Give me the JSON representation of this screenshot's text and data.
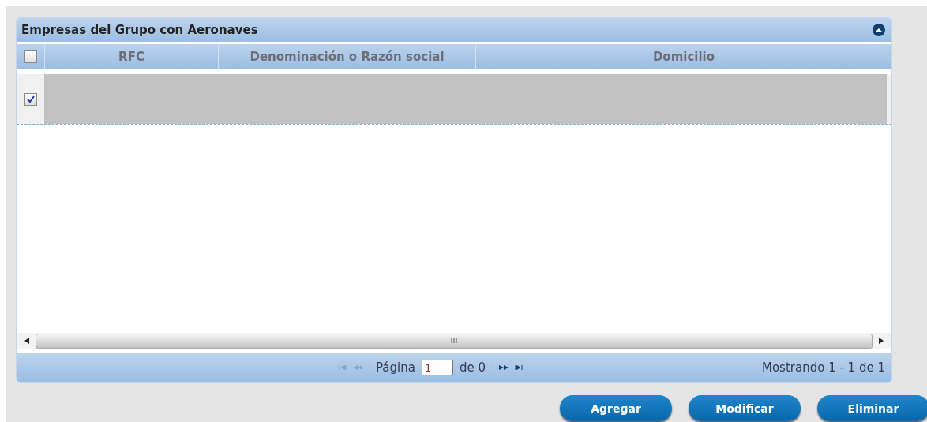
{
  "panel": {
    "title": "Empresas del Grupo con Aeronaves",
    "expanded": true
  },
  "table": {
    "header_checked": false,
    "columns": [
      "RFC",
      "Denominación o Razón social",
      "Domicilio"
    ],
    "rows": [
      {
        "checked": true,
        "selected": true,
        "redacted": true
      }
    ]
  },
  "pager": {
    "page_label": "Página",
    "page_value": "1",
    "of_label": "de 0",
    "status": "Mostrando 1 - 1 de 1"
  },
  "buttons": [
    "Agregar",
    "Modificar",
    "Eliminar"
  ]
}
